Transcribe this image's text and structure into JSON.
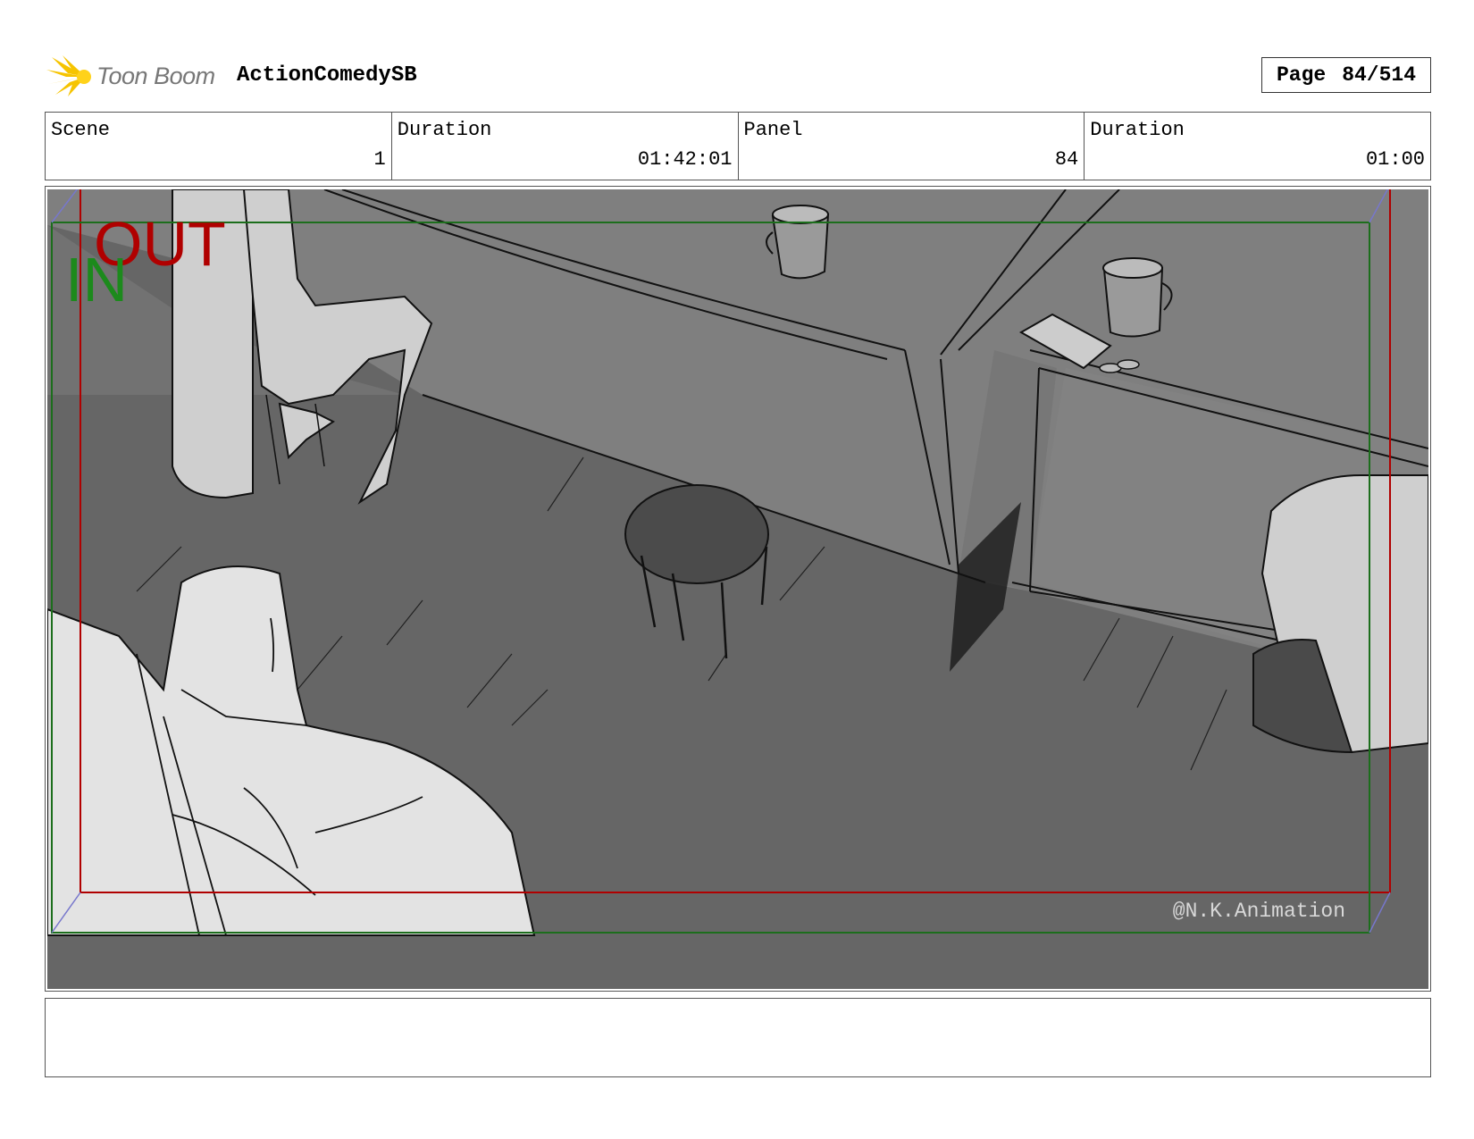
{
  "header": {
    "logo_text": "Toon Boom",
    "project_title": "ActionComedySB",
    "page_label": "Page",
    "page_value": "84/514"
  },
  "info": {
    "scene_label": "Scene",
    "scene_value": "1",
    "scene_duration_label": "Duration",
    "scene_duration_value": "01:42:01",
    "panel_label": "Panel",
    "panel_value": "84",
    "panel_duration_label": "Duration",
    "panel_duration_value": "01:00"
  },
  "panel": {
    "out_label": "OUT",
    "in_label": "IN",
    "watermark": "@N.K.Animation",
    "out_color": "#b00000",
    "in_color": "#1c8a1c"
  },
  "notes": {
    "text": ""
  }
}
